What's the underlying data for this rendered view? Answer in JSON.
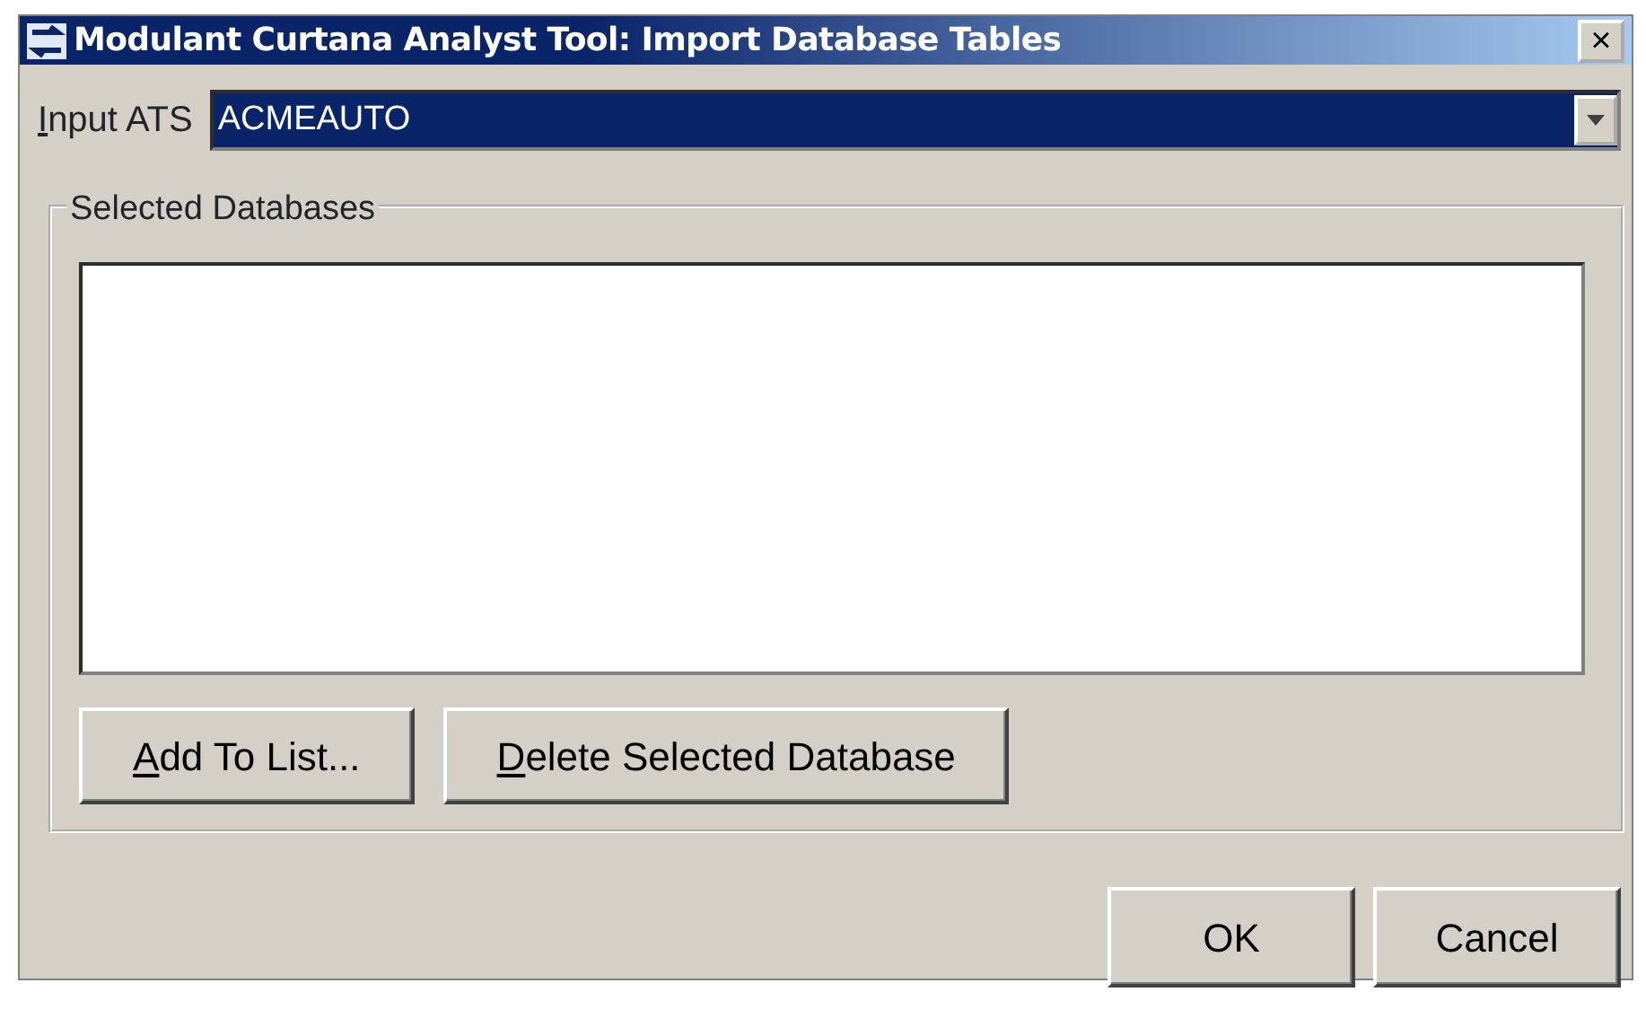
{
  "window": {
    "title": "Modulant Curtana Analyst Tool: Import Database Tables",
    "close": "×"
  },
  "input_ats": {
    "label": "Input ATS",
    "first_letter_underlined": true,
    "value": "ACMEAUTO",
    "selected": true
  },
  "group": {
    "title": "Selected Databases"
  },
  "group_buttons": [
    {
      "label": "Add To List...",
      "first_letter_underlined": true
    },
    {
      "label": "Delete Selected Database",
      "first_letter_underlined": true
    }
  ],
  "buttons": [
    {
      "label": "OK"
    },
    {
      "label": "Cancel"
    }
  ]
}
